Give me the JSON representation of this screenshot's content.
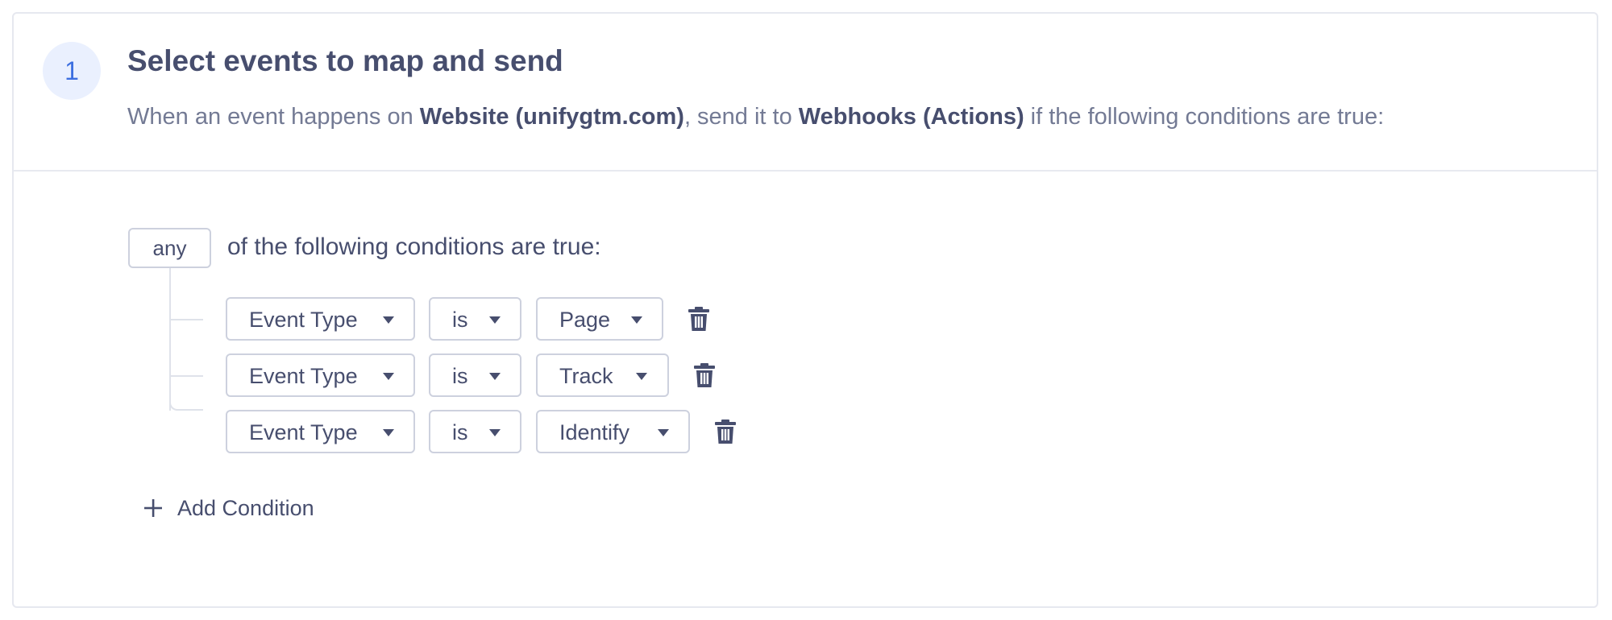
{
  "step": {
    "number": "1",
    "title": "Select events to map and send",
    "description": {
      "prefix": "When an event happens on ",
      "source": "Website (unifygtm.com)",
      "middle": ", send it to ",
      "destination": "Webhooks (Actions)",
      "suffix": " if the following conditions are true:"
    }
  },
  "conditions": {
    "match": "any",
    "match_text": "of the following conditions are true:",
    "rows": [
      {
        "field": "Event Type",
        "operator": "is",
        "value": "Page"
      },
      {
        "field": "Event Type",
        "operator": "is",
        "value": "Track"
      },
      {
        "field": "Event Type",
        "operator": "is",
        "value": "Identify"
      }
    ],
    "add_label": "Add Condition"
  },
  "icons": {
    "step": "step-number-badge",
    "caret": "caret-down-icon",
    "delete": "trash-icon",
    "add": "plus-icon"
  },
  "colors": {
    "text_primary": "#474e6e",
    "text_secondary": "#737a94",
    "accent": "#3d6fe0",
    "accent_bg": "#eaf0fe",
    "border": "#cdd1de"
  }
}
